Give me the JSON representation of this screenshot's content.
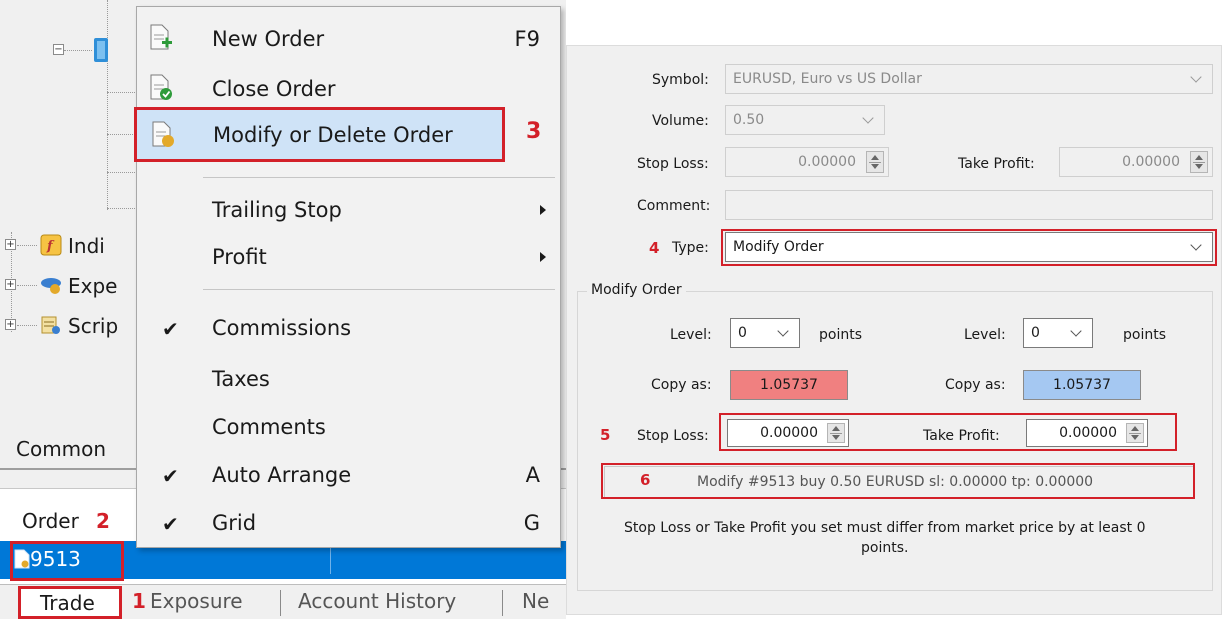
{
  "left": {
    "tree": [
      {
        "label": "Indi",
        "icon": "indicator-icon"
      },
      {
        "label": "Expe",
        "icon": "expert-icon"
      },
      {
        "label": "Scrip",
        "icon": "script-icon"
      }
    ],
    "common_label": "Common",
    "terminal": {
      "header": "Order",
      "header_badge": "2",
      "order_number": "9513"
    },
    "tabs": {
      "trade": "Trade",
      "trade_badge": "1",
      "exposure": "Exposure",
      "account_history": "Account History",
      "news": "Ne"
    },
    "menu": {
      "new_order": "New Order",
      "new_order_key": "F9",
      "close_order": "Close Order",
      "modify_order": "Modify or Delete Order",
      "modify_badge": "3",
      "trailing_stop": "Trailing Stop",
      "profit": "Profit",
      "commissions": "Commissions",
      "taxes": "Taxes",
      "comments": "Comments",
      "auto_arrange": "Auto Arrange",
      "auto_arrange_key": "A",
      "grid": "Grid",
      "grid_key": "G",
      "check_mark": "✔"
    }
  },
  "right": {
    "symbol_label": "Symbol:",
    "symbol_value": "EURUSD, Euro vs US Dollar",
    "volume_label": "Volume:",
    "volume_value": "0.50",
    "stop_loss_label": "Stop Loss:",
    "stop_loss_value": "0.00000",
    "take_profit_label": "Take Profit:",
    "take_profit_value": "0.00000",
    "comment_label": "Comment:",
    "type_badge": "4",
    "type_label": "Type:",
    "type_value": "Modify Order",
    "group_title": "Modify Order",
    "level_label": "Level:",
    "level_left_value": "0",
    "level_right_value": "0",
    "points_label": "points",
    "copy_as_label": "Copy as:",
    "copy_left_value": "1.05737",
    "copy_right_value": "1.05737",
    "copy_left_color": "#f08080",
    "copy_right_color": "#a5c8f2",
    "sl_badge": "5",
    "sl_label": "Stop Loss:",
    "sl_value": "0.00000",
    "tp_label": "Take Profit:",
    "tp_value": "0.00000",
    "modify_badge": "6",
    "modify_text": "Modify #9513 buy 0.50 EURUSD sl: 0.00000 tp: 0.00000",
    "note_line1": "Stop Loss or Take Profit you set must differ from market price by at least 0",
    "note_line2": "points."
  },
  "colors": {
    "highlight_red": "#d32029",
    "selection_blue": "#0078d7"
  }
}
